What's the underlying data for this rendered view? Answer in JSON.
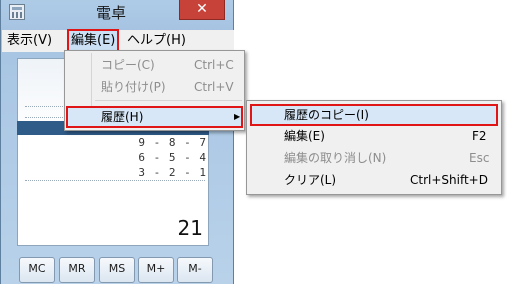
{
  "window": {
    "title": "電卓",
    "close_icon": "✕"
  },
  "menubar": {
    "view": "表示(V)",
    "edit": "編集(E)",
    "help": "ヘルプ(H)"
  },
  "history_rows": [
    "9 - 8 - 7",
    "6 - 5 - 4",
    "3 - 2 - 1"
  ],
  "display": {
    "value": "21"
  },
  "memory_buttons": [
    "MC",
    "MR",
    "MS",
    "M+",
    "M-"
  ],
  "edit_menu": {
    "copy": {
      "label": "コピー(C)",
      "shortcut": "Ctrl+C"
    },
    "paste": {
      "label": "貼り付け(P)",
      "shortcut": "Ctrl+V"
    },
    "history": {
      "label": "履歴(H)",
      "arrow": "▶"
    }
  },
  "history_submenu": {
    "copy_history": {
      "label": "履歴のコピー(I)"
    },
    "edit": {
      "label": "編集(E)",
      "shortcut": "F2"
    },
    "cancel_edit": {
      "label": "編集の取り消し(N)",
      "shortcut": "Esc"
    },
    "clear": {
      "label": "クリア(L)",
      "shortcut": "Ctrl+Shift+D"
    }
  },
  "colors": {
    "highlight_outline": "#e01515",
    "selected_history_row": "#2f5b89"
  }
}
